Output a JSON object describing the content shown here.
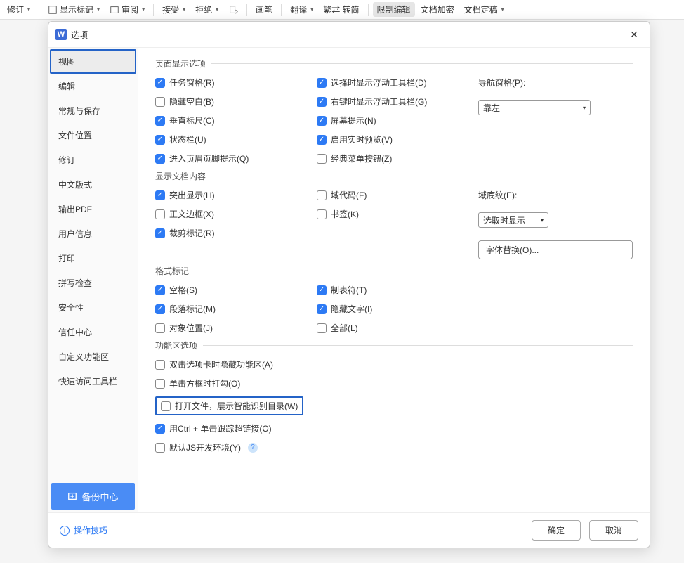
{
  "toolbar": {
    "revise": "修订",
    "show_marks": "显示标记",
    "review": "审阅",
    "accept": "接受",
    "reject": "拒绝",
    "pen": "画笔",
    "translate": "翻译",
    "trad_simp": "繁⇄ 转简",
    "restrict_edit": "限制编辑",
    "doc_encrypt": "文档加密",
    "doc_final": "文档定稿"
  },
  "dialog": {
    "title": "选项",
    "close": "×"
  },
  "sidebar": {
    "items": [
      "视图",
      "编辑",
      "常规与保存",
      "文件位置",
      "修订",
      "中文版式",
      "输出PDF",
      "用户信息",
      "打印",
      "拼写检查",
      "安全性",
      "信任中心",
      "自定义功能区",
      "快速访问工具栏"
    ],
    "backup": "备份中心"
  },
  "groups": {
    "g1": {
      "title": "页面显示选项",
      "c1": [
        "任务窗格(R)",
        "隐藏空白(B)",
        "垂直标尺(C)",
        "状态栏(U)",
        "进入页眉页脚提示(Q)"
      ],
      "c1_checked": [
        true,
        false,
        true,
        true,
        true
      ],
      "c2": [
        "选择时显示浮动工具栏(D)",
        "右键时显示浮动工具栏(G)",
        "屏幕提示(N)",
        "启用实时预览(V)",
        "经典菜单按钮(Z)"
      ],
      "c2_checked": [
        true,
        true,
        true,
        true,
        false
      ],
      "nav_label": "导航窗格(P):",
      "nav_value": "靠左"
    },
    "g2": {
      "title": "显示文档内容",
      "c1": [
        "突出显示(H)",
        "正文边框(X)",
        "裁剪标记(R)"
      ],
      "c1_checked": [
        true,
        false,
        true
      ],
      "c2": [
        "域代码(F)",
        "书签(K)"
      ],
      "c2_checked": [
        false,
        false
      ],
      "shade_label": "域底纹(E):",
      "shade_value": "选取时显示",
      "font_sub": "字体替换(O)..."
    },
    "g3": {
      "title": "格式标记",
      "c1": [
        "空格(S)",
        "段落标记(M)",
        "对象位置(J)"
      ],
      "c1_checked": [
        true,
        true,
        false
      ],
      "c2": [
        "制表符(T)",
        "隐藏文字(I)",
        "全部(L)"
      ],
      "c2_checked": [
        true,
        true,
        false
      ]
    },
    "g4": {
      "title": "功能区选项",
      "items": [
        "双击选项卡时隐藏功能区(A)",
        "单击方框时打勾(O)",
        "打开文件，展示智能识别目录(W)",
        "用Ctrl + 单击跟踪超链接(O)",
        "默认JS开发环境(Y)"
      ],
      "checked": [
        false,
        false,
        false,
        true,
        false
      ]
    }
  },
  "footer": {
    "tips": "操作技巧",
    "ok": "确定",
    "cancel": "取消"
  }
}
